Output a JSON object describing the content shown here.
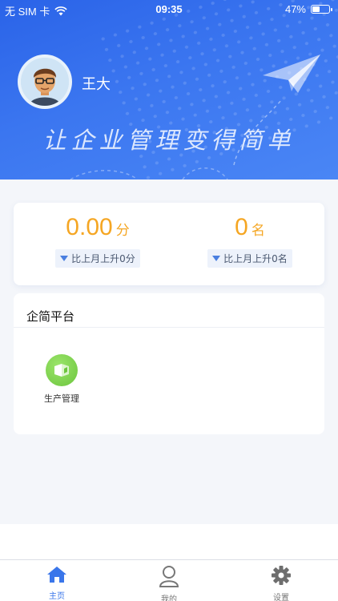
{
  "status_bar": {
    "carrier": "无 SIM 卡",
    "time": "09:35",
    "battery": "47%",
    "battery_level": 0.47
  },
  "user": {
    "name": "王大"
  },
  "banner": {
    "slogan": "让企业管理变得简单"
  },
  "score": {
    "points_value": "0.00",
    "points_unit": "分",
    "points_delta": "比上月上升0分",
    "rank_value": "0",
    "rank_unit": "名",
    "rank_delta": "比上月上升0名"
  },
  "platform": {
    "title": "企简平台",
    "apps": [
      {
        "label": "生产管理",
        "icon": "production-icon"
      }
    ]
  },
  "tabbar": {
    "items": [
      {
        "label": "主页",
        "icon": "home-icon",
        "active": true
      },
      {
        "label": "我的",
        "icon": "user-icon",
        "active": false
      },
      {
        "label": "设置",
        "icon": "gear-icon",
        "active": false
      }
    ]
  },
  "colors": {
    "primary": "#2f6ae9",
    "accent": "#f5a623",
    "app_green": "#6cc53e"
  }
}
